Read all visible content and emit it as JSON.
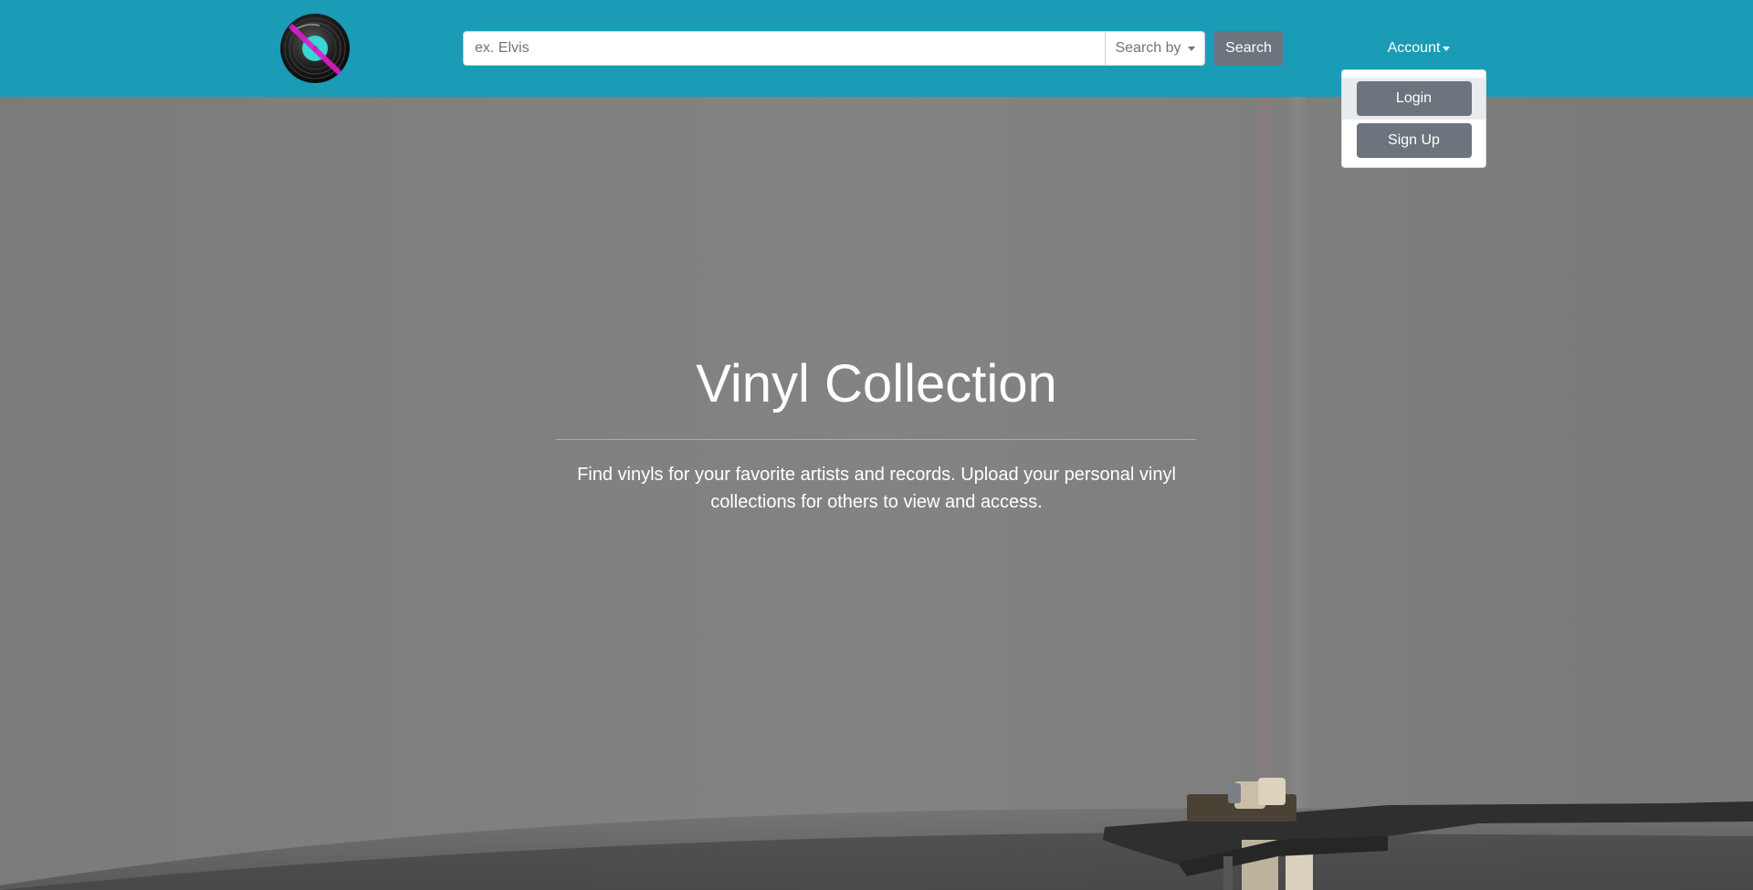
{
  "navbar": {
    "logo_icon": "vinyl-record-logo-icon",
    "search": {
      "placeholder": "ex. Elvis",
      "value": "",
      "search_by_label": "Search by",
      "button_label": "Search"
    },
    "account_label": "Account"
  },
  "account_menu": {
    "open": true,
    "items": [
      {
        "label": "Login",
        "highlighted": true
      },
      {
        "label": "Sign Up",
        "highlighted": false
      }
    ]
  },
  "hero": {
    "title": "Vinyl Collection",
    "description": "Find vinyls for your favorite artists and records. Upload your personal vinyl collections for others to view and access."
  },
  "colors": {
    "navbar": "#1a9bb6",
    "button": "#6c757d",
    "hero_background": "#7f7f7f",
    "logo_accent_cyan": "#3ad6d0",
    "logo_accent_magenta": "#e01ad0"
  }
}
